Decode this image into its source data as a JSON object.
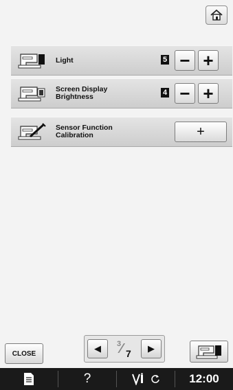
{
  "rows": [
    {
      "label": "Light",
      "value": "5"
    },
    {
      "label": "Screen Display\nBrightness",
      "value": "4"
    },
    {
      "label": "Sensor Function\nCalibration"
    }
  ],
  "controls": {
    "minus": "−",
    "plus": "+",
    "calibrate": "+"
  },
  "footer": {
    "close_label": "CLOSE",
    "page_current": "3",
    "page_total": "7",
    "prev_glyph": "◀",
    "next_glyph": "▶"
  },
  "status_bar": {
    "help": "?",
    "time": "12:00"
  },
  "icons": [
    "home-icon",
    "sewing-machine-light-icon",
    "sewing-machine-screen-icon",
    "sensor-calibration-icon",
    "sewing-machine-icon",
    "document-icon",
    "help-icon",
    "needle-bobbin-icon",
    "rotate-icon"
  ]
}
